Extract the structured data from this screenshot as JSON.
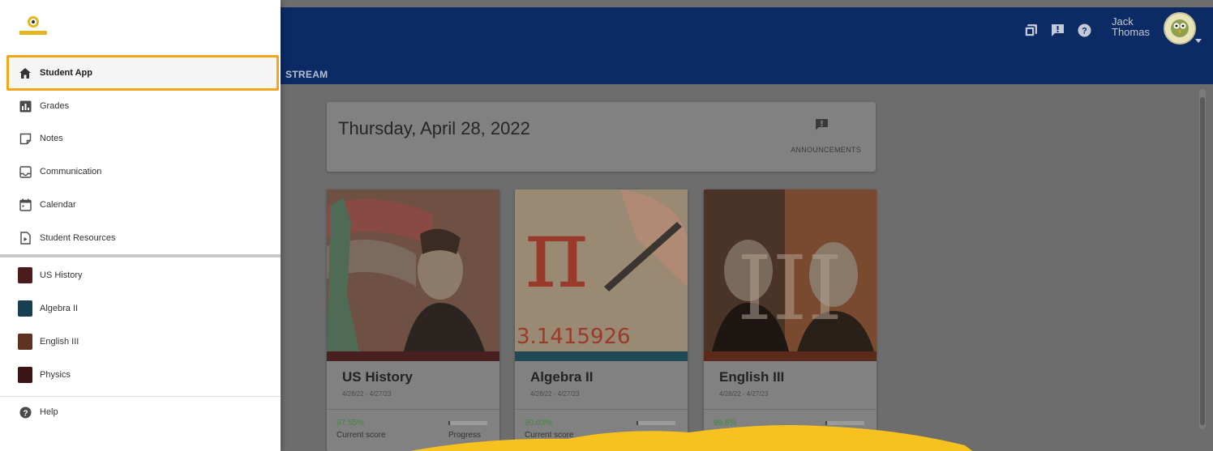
{
  "topbar": {
    "stream_tab": "STREAM",
    "user_first": "Jack",
    "user_last": "Thomas",
    "icons": [
      "gallery-icon",
      "announcement-icon",
      "help-icon"
    ]
  },
  "date_card": {
    "date": "Thursday, April 28, 2022",
    "announcements_label": "ANNOUNCEMENTS"
  },
  "courses": [
    {
      "title": "US History",
      "dates": "4/28/22 - 4/27/23",
      "score": "97.55%",
      "score_label": "Current score",
      "progress_label": "Progress",
      "progress": 0.05,
      "band_color": "#4a1f1f"
    },
    {
      "title": "Algebra II",
      "dates": "4/28/22 - 4/27/23",
      "score": "90.03%",
      "score_label": "Current score",
      "progress_label": "",
      "progress": 0.04,
      "band_color": "#1f4a55"
    },
    {
      "title": "English III",
      "dates": "4/28/22 - 4/27/23",
      "score": "99.6%",
      "score_label": "",
      "progress_label": "",
      "progress": 0.05,
      "band_color": "#5a2a1a"
    }
  ],
  "sidebar": {
    "items": [
      {
        "label": "Student App",
        "icon": "home-icon"
      },
      {
        "label": "Grades",
        "icon": "grades-icon"
      },
      {
        "label": "Notes",
        "icon": "notes-icon"
      },
      {
        "label": "Communication",
        "icon": "inbox-icon"
      },
      {
        "label": "Calendar",
        "icon": "calendar-icon"
      },
      {
        "label": "Student Resources",
        "icon": "resources-icon"
      }
    ],
    "courses": [
      {
        "label": "US History",
        "color": "#4a1c1c"
      },
      {
        "label": "Algebra II",
        "color": "#183e52"
      },
      {
        "label": "English III",
        "color": "#5e3120"
      },
      {
        "label": "Physics",
        "color": "#3b1515"
      }
    ],
    "help_label": "Help"
  },
  "colors": {
    "topbar": "#0c2a63",
    "active_outline": "#f0a81a",
    "highlight": "#f7c21f"
  }
}
